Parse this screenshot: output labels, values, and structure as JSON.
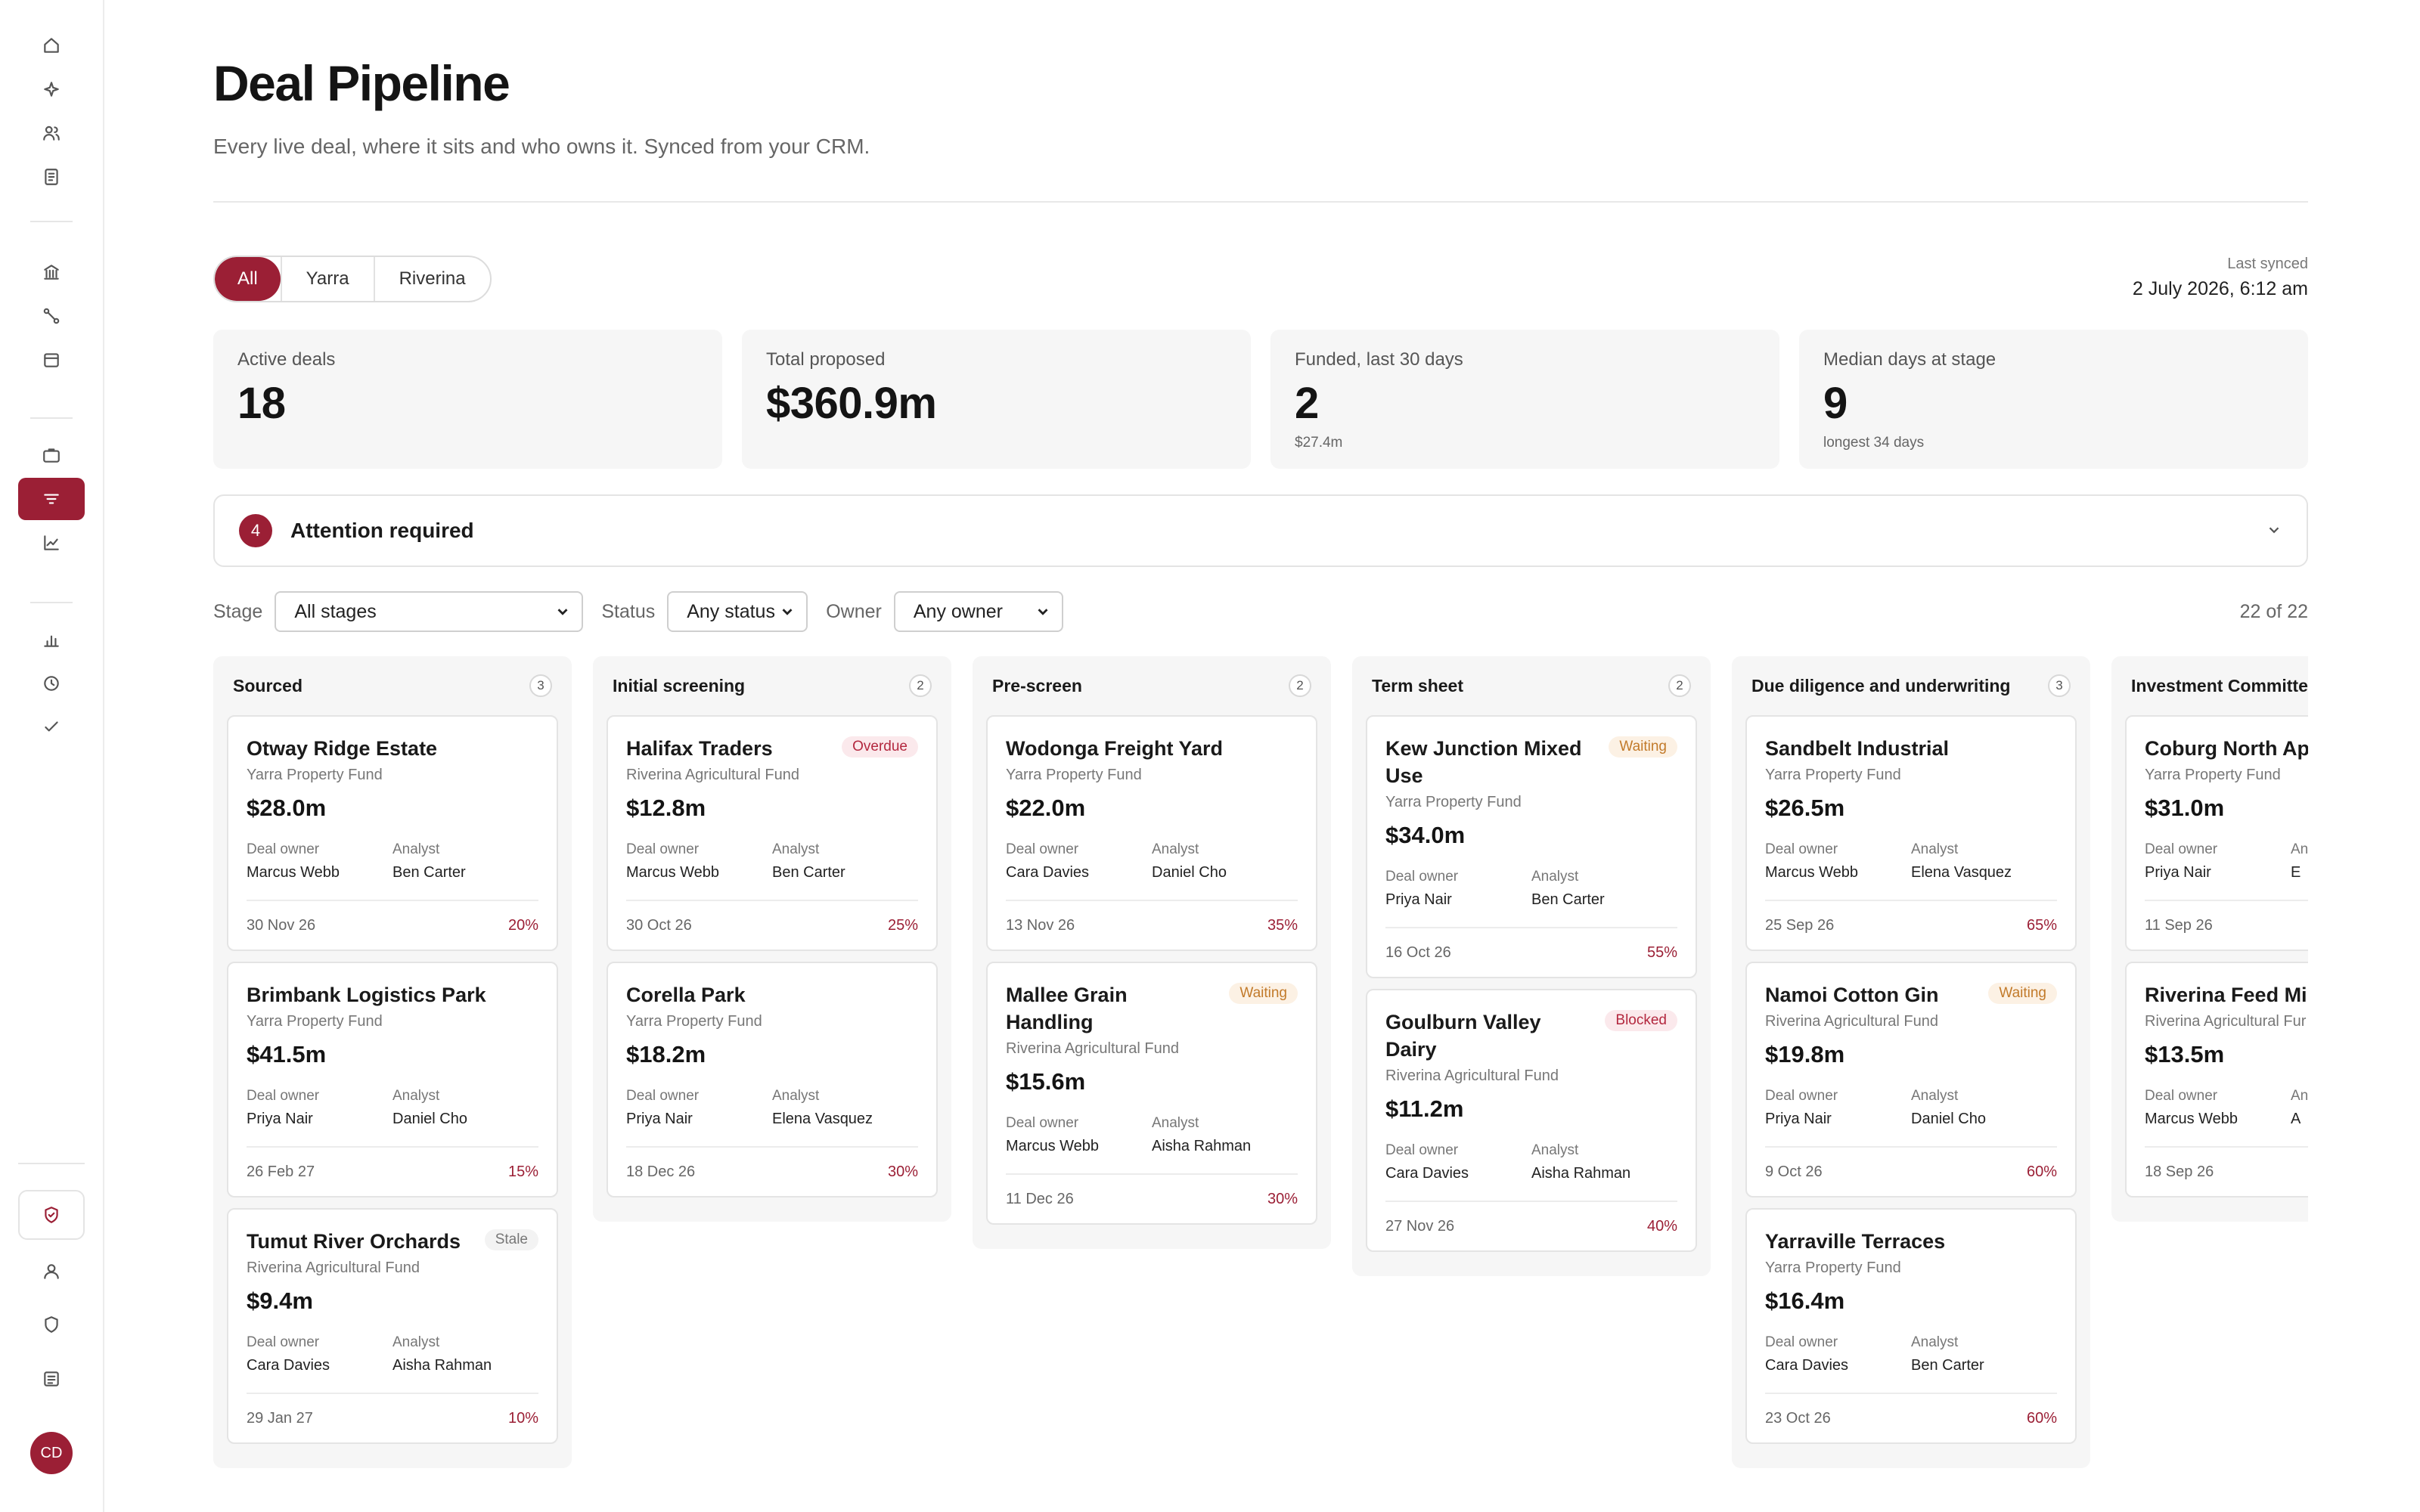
{
  "page": {
    "title": "Deal Pipeline",
    "subtitle": "Every live deal, where it sits and who owns it. Synced from your CRM."
  },
  "tabs": [
    "All",
    "Yarra",
    "Riverina"
  ],
  "sync": {
    "label": "Last synced",
    "value": "2 July 2026, 6:12 am"
  },
  "kpis": [
    {
      "label": "Active deals",
      "value": "18",
      "sub": ""
    },
    {
      "label": "Total proposed",
      "value": "$360.9m",
      "sub": ""
    },
    {
      "label": "Funded, last 30 days",
      "value": "2",
      "sub": "$27.4m"
    },
    {
      "label": "Median days at stage",
      "value": "9",
      "sub": "longest 34 days"
    }
  ],
  "attention": {
    "count": "4",
    "title": "Attention required"
  },
  "filters": {
    "stage_label": "Stage",
    "stage_value": "All stages",
    "status_label": "Status",
    "status_value": "Any status",
    "owner_label": "Owner",
    "owner_value": "Any owner",
    "result_count": "22 of 22"
  },
  "labels": {
    "deal_owner": "Deal owner",
    "analyst": "Analyst"
  },
  "columns": [
    {
      "title": "Sourced",
      "count": "3",
      "cards": [
        {
          "name": "Otway Ridge Estate",
          "badge": "",
          "fund": "Yarra Property Fund",
          "amount": "$28.0m",
          "owner": "Marcus Webb",
          "analyst": "Ben Carter",
          "date": "30 Nov 26",
          "prob": "20%"
        },
        {
          "name": "Brimbank Logistics Park",
          "badge": "",
          "fund": "Yarra Property Fund",
          "amount": "$41.5m",
          "owner": "Priya Nair",
          "analyst": "Daniel Cho",
          "date": "26 Feb 27",
          "prob": "15%"
        },
        {
          "name": "Tumut River Orchards",
          "badge": "Stale",
          "fund": "Riverina Agricultural Fund",
          "amount": "$9.4m",
          "owner": "Cara Davies",
          "analyst": "Aisha Rahman",
          "date": "29 Jan 27",
          "prob": "10%"
        }
      ]
    },
    {
      "title": "Initial screening",
      "count": "2",
      "cards": [
        {
          "name": "Halifax Traders",
          "badge": "Overdue",
          "fund": "Riverina Agricultural Fund",
          "amount": "$12.8m",
          "owner": "Marcus Webb",
          "analyst": "Ben Carter",
          "date": "30 Oct 26",
          "prob": "25%"
        },
        {
          "name": "Corella Park",
          "badge": "",
          "fund": "Yarra Property Fund",
          "amount": "$18.2m",
          "owner": "Priya Nair",
          "analyst": "Elena Vasquez",
          "date": "18 Dec 26",
          "prob": "30%"
        }
      ]
    },
    {
      "title": "Pre-screen",
      "count": "2",
      "cards": [
        {
          "name": "Wodonga Freight Yard",
          "badge": "",
          "fund": "Yarra Property Fund",
          "amount": "$22.0m",
          "owner": "Cara Davies",
          "analyst": "Daniel Cho",
          "date": "13 Nov 26",
          "prob": "35%"
        },
        {
          "name": "Mallee Grain Handling",
          "badge": "Waiting",
          "fund": "Riverina Agricultural Fund",
          "amount": "$15.6m",
          "owner": "Marcus Webb",
          "analyst": "Aisha Rahman",
          "date": "11 Dec 26",
          "prob": "30%"
        }
      ]
    },
    {
      "title": "Term sheet",
      "count": "2",
      "cards": [
        {
          "name": "Kew Junction Mixed Use",
          "badge": "Waiting",
          "fund": "Yarra Property Fund",
          "amount": "$34.0m",
          "owner": "Priya Nair",
          "analyst": "Ben Carter",
          "date": "16 Oct 26",
          "prob": "55%"
        },
        {
          "name": "Goulburn Valley Dairy",
          "badge": "Blocked",
          "fund": "Riverina Agricultural Fund",
          "amount": "$11.2m",
          "owner": "Cara Davies",
          "analyst": "Aisha Rahman",
          "date": "27 Nov 26",
          "prob": "40%"
        }
      ]
    },
    {
      "title": "Due diligence and underwriting",
      "count": "3",
      "cards": [
        {
          "name": "Sandbelt Industrial",
          "badge": "",
          "fund": "Yarra Property Fund",
          "amount": "$26.5m",
          "owner": "Marcus Webb",
          "analyst": "Elena Vasquez",
          "date": "25 Sep 26",
          "prob": "65%"
        },
        {
          "name": "Namoi Cotton Gin",
          "badge": "Waiting",
          "fund": "Riverina Agricultural Fund",
          "amount": "$19.8m",
          "owner": "Priya Nair",
          "analyst": "Daniel Cho",
          "date": "9 Oct 26",
          "prob": "60%"
        },
        {
          "name": "Yarraville Terraces",
          "badge": "",
          "fund": "Yarra Property Fund",
          "amount": "$16.4m",
          "owner": "Cara Davies",
          "analyst": "Ben Carter",
          "date": "23 Oct 26",
          "prob": "60%"
        }
      ]
    },
    {
      "title": "Investment Committe",
      "count": "",
      "cards": [
        {
          "name": "Coburg North Apa",
          "badge": "",
          "fund": "Yarra Property Fund",
          "amount": "$31.0m",
          "owner": "Priya Nair",
          "analyst": "E",
          "date": "11 Sep 26",
          "prob": ""
        },
        {
          "name": "Riverina Feed Mill",
          "badge": "",
          "fund": "Riverina Agricultural Fur",
          "amount": "$13.5m",
          "owner": "Marcus Webb",
          "analyst": "A",
          "date": "18 Sep 26",
          "prob": ""
        }
      ]
    }
  ],
  "user": {
    "initials": "CD"
  },
  "colors": {
    "accent": "#9b1f35",
    "card_bg": "#ffffff",
    "column_bg": "#f6f6f6"
  }
}
